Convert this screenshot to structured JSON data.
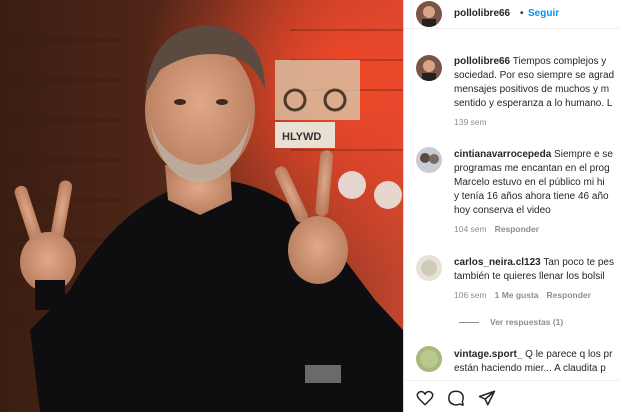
{
  "post": {
    "username": "pollolibre66",
    "follow_label": "Seguir",
    "caption": {
      "username": "pollolibre66",
      "lines": [
        "Tiempos complejos y",
        "sociedad. Por eso siempre se agrad",
        "mensajes positivos de muchos y m",
        "sentido y esperanza a lo humano. L"
      ],
      "time": "139 sem"
    }
  },
  "comments": [
    {
      "username": "cintianavarrocepeda",
      "lines": [
        "Siempre e se",
        "programas me encantan en el prog",
        "Marcelo estuvo en el público mi hi",
        "y tenía 16 años ahora tiene 46 año",
        "hoy conserva el video"
      ],
      "time": "104 sem",
      "reply": "Responder"
    },
    {
      "username": "carlos_neira.cl123",
      "lines": [
        "Tan poco te pes",
        "también te quieres llenar los bolsil"
      ],
      "time": "106 sem",
      "likes": "1 Me gusta",
      "reply": "Responder",
      "view_replies": "Ver respuestas (1)"
    },
    {
      "username": "vintage.sport_",
      "lines": [
        "Q le parece q los pr",
        "están haciendo mier... A claudita p"
      ],
      "time": "",
      "reply": ""
    }
  ],
  "photo_signs": {
    "hlywd": "HLYWD"
  },
  "colors": {
    "link": "#0095f6",
    "text": "#262626",
    "muted": "#8e8e8e"
  },
  "icons": [
    "heart-icon",
    "comment-icon",
    "share-icon"
  ]
}
